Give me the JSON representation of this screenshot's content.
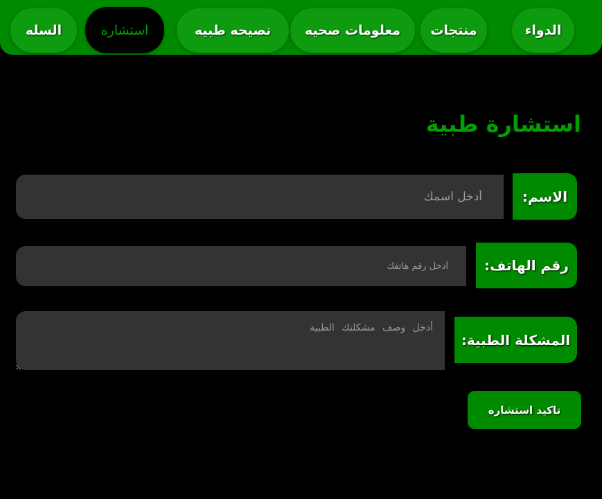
{
  "nav": {
    "items": [
      {
        "label": "الدواء"
      },
      {
        "label": "منتجات"
      },
      {
        "label": "معلومات صحيه"
      },
      {
        "label": "نصيحه طبيه"
      },
      {
        "label": "استشاره",
        "active": true
      },
      {
        "label": "السله"
      }
    ]
  },
  "main": {
    "title": "استشارة طبية"
  },
  "form": {
    "name_label": "الاسم:",
    "name_placeholder": "أدخل اسمك",
    "phone_label": "رقم الهاتف:",
    "phone_placeholder": "أدخل رقم هاتفك",
    "problem_label": "المشكلة الطبية:",
    "problem_placeholder": "أدخل وصف مشكلتك الطبية",
    "submit_label": "تاكيد استشاره"
  },
  "colors": {
    "accent": "#008a00",
    "accent_text": "#00a000",
    "background": "#000000",
    "field_bg": "#333333"
  }
}
